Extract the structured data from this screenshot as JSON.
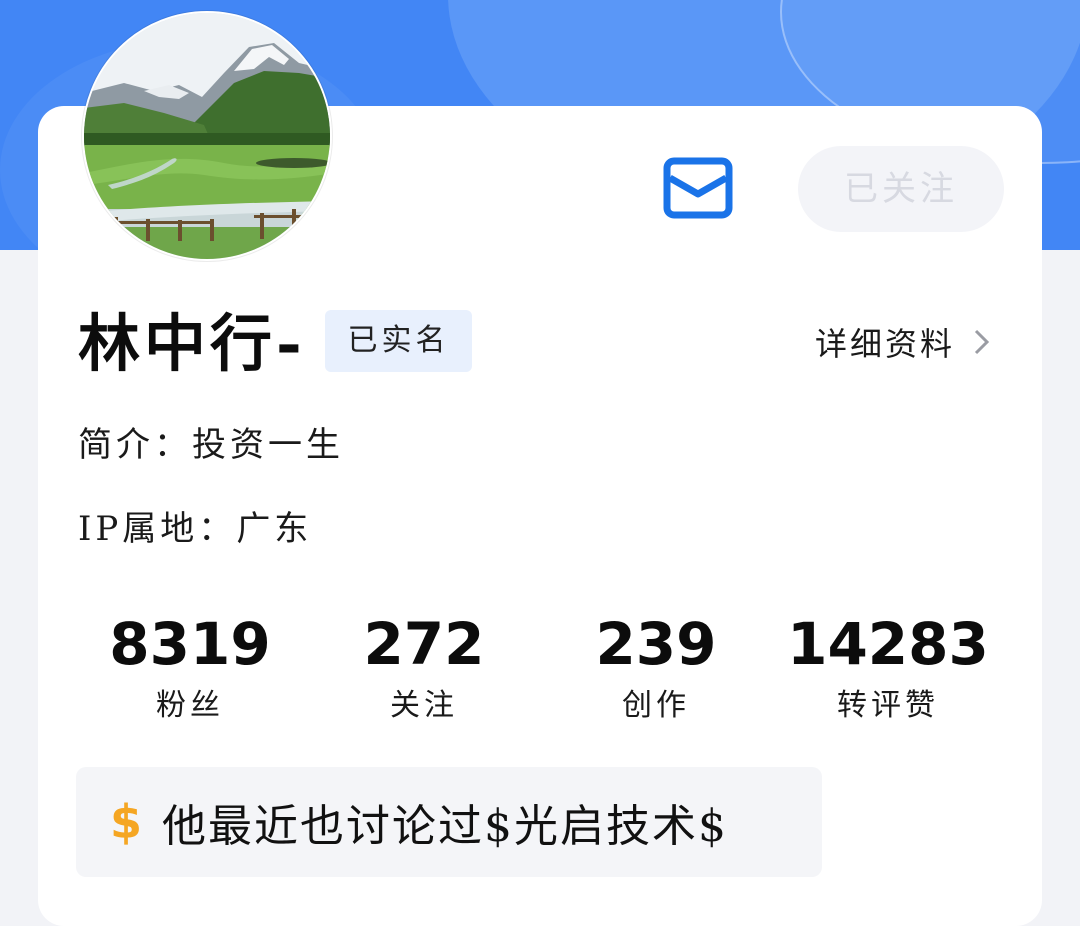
{
  "profile": {
    "name": "林中行-",
    "verified_label": "已实名",
    "follow_label": "已关注",
    "detail_label": "详细资料",
    "bio_label": "简介：",
    "bio": "投资一生",
    "ip_label": "IP属地：",
    "ip_location": "广东"
  },
  "stats": [
    {
      "value": "8319",
      "label": "粉丝"
    },
    {
      "value": "272",
      "label": "关注"
    },
    {
      "value": "239",
      "label": "创作"
    },
    {
      "value": "14283",
      "label": "转评赞"
    }
  ],
  "topic": {
    "icon": "$",
    "text": "他最近也讨论过$光启技术$"
  },
  "icons": {
    "mail": "mail-icon",
    "chevron": "chevron-right-icon"
  },
  "colors": {
    "hero": "#4286f5",
    "accent": "#1a73e8",
    "badge_bg": "#e8f0fd",
    "dollar": "#f5a623"
  }
}
